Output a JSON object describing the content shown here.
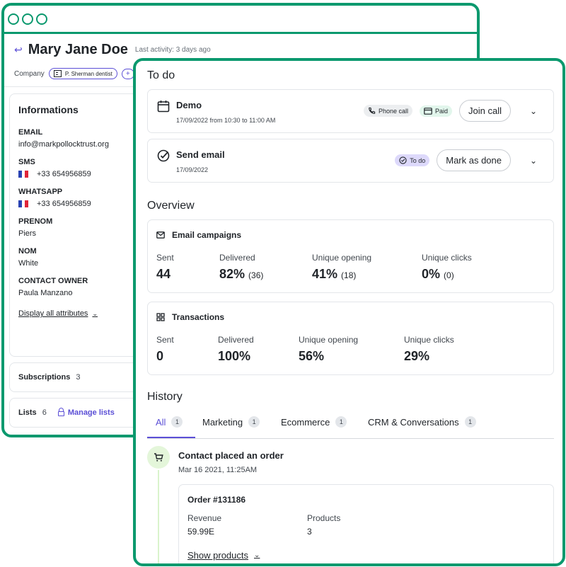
{
  "contact": {
    "name": "Mary Jane Doe",
    "last_activity": "Last activity: 3 days ago",
    "company_label": "Company",
    "company_chip": "P. Sherman dentist",
    "add_chip": "+"
  },
  "informations": {
    "title": "Informations",
    "attributes": [
      {
        "label": "EMAIL",
        "value": "info@markpollocktrust.org"
      },
      {
        "label": "SMS",
        "value": "+33 654956859"
      },
      {
        "label": "WHATSAPP",
        "value": "+33 654956859"
      },
      {
        "label": "PRENOM",
        "value": "Piers"
      },
      {
        "label": "NOM",
        "value": "White"
      },
      {
        "label": "CONTACT OWNER",
        "value": "Paula Manzano"
      }
    ],
    "display_all": "Display all attributes"
  },
  "subscriptions": {
    "label": "Subscriptions",
    "count": "3"
  },
  "lists": {
    "label": "Lists",
    "count": "6",
    "manage": "Manage lists"
  },
  "todo": {
    "title": "To do",
    "items": [
      {
        "name": "Demo",
        "date": "17/09/2022 from 10:30 to 11:00 AM",
        "tags": [
          "Phone call",
          "Paid"
        ],
        "action": "Join call"
      },
      {
        "name": "Send email",
        "date": "17/09/2022",
        "tags": [
          "To do"
        ],
        "action": "Mark as done"
      }
    ]
  },
  "overview": {
    "title": "Overview",
    "email_campaigns": {
      "title": "Email campaigns",
      "stats": [
        {
          "label": "Sent",
          "value": "44",
          "sub": ""
        },
        {
          "label": "Delivered",
          "value": "82%",
          "sub": "(36)"
        },
        {
          "label": "Unique opening",
          "value": "41%",
          "sub": "(18)"
        },
        {
          "label": "Unique clicks",
          "value": "0%",
          "sub": "(0)"
        }
      ]
    },
    "transactions": {
      "title": "Transactions",
      "stats": [
        {
          "label": "Sent",
          "value": "0"
        },
        {
          "label": "Delivered",
          "value": "100%"
        },
        {
          "label": "Unique opening",
          "value": "56%"
        },
        {
          "label": "Unique clicks",
          "value": "29%"
        }
      ]
    }
  },
  "history": {
    "title": "History",
    "tabs": [
      {
        "label": "All",
        "count": "1"
      },
      {
        "label": "Marketing",
        "count": "1"
      },
      {
        "label": "Ecommerce",
        "count": "1"
      },
      {
        "label": "CRM & Conversations",
        "count": "1"
      }
    ],
    "event": {
      "title": "Contact placed an order",
      "time": "Mar 16 2021, 11:25AM",
      "order_title": "Order #131186",
      "revenue_label": "Revenue",
      "revenue_value": "59.99E",
      "products_label": "Products",
      "products_value": "3",
      "show_products": "Show products"
    }
  },
  "colors": {
    "frame": "#0b996e",
    "accent": "#5b4fd6",
    "history_icon_bg": "#e4f6da"
  }
}
